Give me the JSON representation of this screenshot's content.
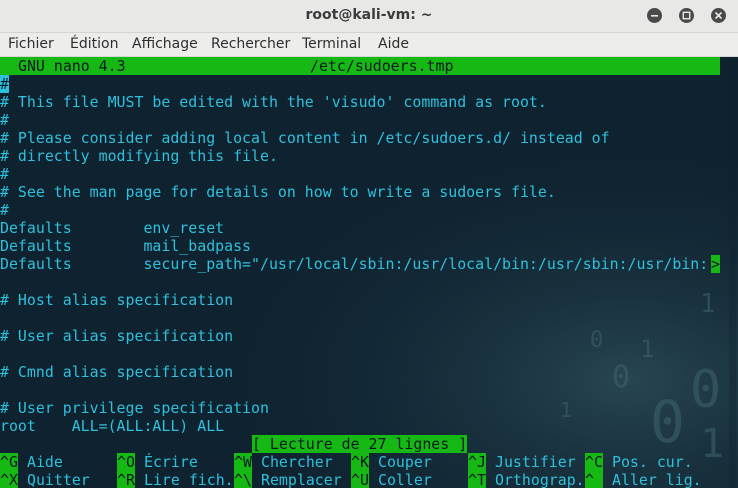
{
  "window": {
    "title": "root@kali-vm: ~"
  },
  "menu": [
    "Fichier",
    "Édition",
    "Affichage",
    "Rechercher",
    "Terminal",
    "Aide"
  ],
  "nano": {
    "version": "GNU nano 4.3",
    "filename": "/etc/sudoers.tmp",
    "cursor_char": "#",
    "lines": [
      "",
      "# This file MUST be edited with the 'visudo' command as root.",
      "#",
      "# Please consider adding local content in /etc/sudoers.d/ instead of",
      "# directly modifying this file.",
      "#",
      "# See the man page for details on how to write a sudoers file.",
      "#",
      "Defaults        env_reset",
      "Defaults        mail_badpass",
      "Defaults        secure_path=\"/usr/local/sbin:/usr/local/bin:/usr/sbin:/usr/bin:",
      "",
      "# Host alias specification",
      "",
      "# User alias specification",
      "",
      "# Cmnd alias specification",
      "",
      "# User privilege specification",
      "root    ALL=(ALL:ALL) ALL"
    ],
    "more_marker": ">",
    "status": "[ Lecture de 27 lignes ]",
    "shortcuts": [
      [
        {
          "key": "^G",
          "label": "Aide"
        },
        {
          "key": "^O",
          "label": "Écrire"
        },
        {
          "key": "^W",
          "label": "Chercher"
        },
        {
          "key": "^K",
          "label": "Couper"
        },
        {
          "key": "^J",
          "label": "Justifier"
        },
        {
          "key": "^C",
          "label": "Pos. cur."
        }
      ],
      [
        {
          "key": "^X",
          "label": "Quitter"
        },
        {
          "key": "^R",
          "label": "Lire fich."
        },
        {
          "key": "^\\",
          "label": "Remplacer"
        },
        {
          "key": "^U",
          "label": "Coller"
        },
        {
          "key": "^T",
          "label": "Orthograp."
        },
        {
          "key": "^_",
          "label": "Aller lig."
        }
      ]
    ]
  }
}
